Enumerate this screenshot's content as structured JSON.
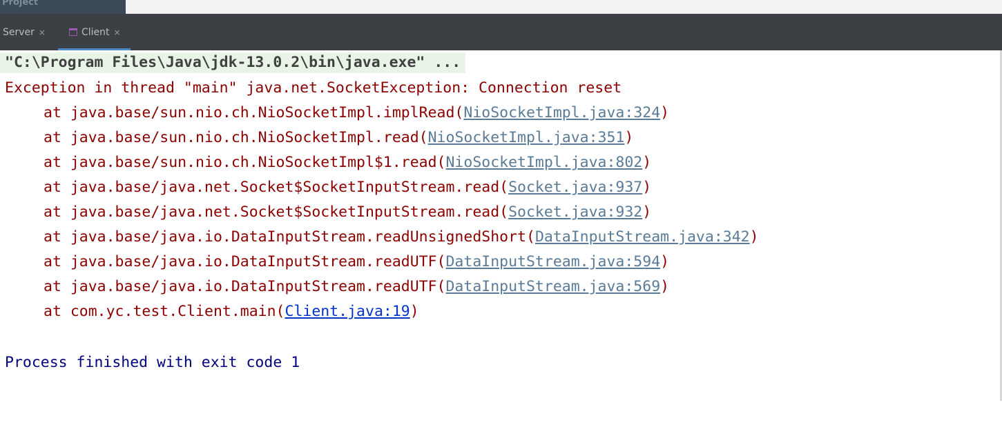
{
  "window": {
    "project_label": "Project"
  },
  "tabs": [
    {
      "label": "Server",
      "close": "×"
    },
    {
      "label": "Client",
      "close": "×",
      "icon": "window-icon",
      "active": true
    }
  ],
  "console": {
    "command": "\"C:\\Program Files\\Java\\jdk-13.0.2\\bin\\java.exe\" ...",
    "exception": "Exception in thread \"main\" java.net.SocketException: Connection reset",
    "trace": [
      {
        "text": "at java.base/sun.nio.ch.NioSocketImpl.implRead(",
        "link": "NioSocketImpl.java:324",
        "close": ")"
      },
      {
        "text": "at java.base/sun.nio.ch.NioSocketImpl.read(",
        "link": "NioSocketImpl.java:351",
        "close": ")"
      },
      {
        "text": "at java.base/sun.nio.ch.NioSocketImpl$1.read(",
        "link": "NioSocketImpl.java:802",
        "close": ")"
      },
      {
        "text": "at java.base/java.net.Socket$SocketInputStream.read(",
        "link": "Socket.java:937",
        "close": ")"
      },
      {
        "text": "at java.base/java.net.Socket$SocketInputStream.read(",
        "link": "Socket.java:932",
        "close": ")"
      },
      {
        "text": "at java.base/java.io.DataInputStream.readUnsignedShort(",
        "link": "DataInputStream.java:342",
        "close": ")"
      },
      {
        "text": "at java.base/java.io.DataInputStream.readUTF(",
        "link": "DataInputStream.java:594",
        "close": ")"
      },
      {
        "text": "at java.base/java.io.DataInputStream.readUTF(",
        "link": "DataInputStream.java:569",
        "close": ")"
      },
      {
        "text": "at com.yc.test.Client.main(",
        "link": "Client.java:19",
        "close": ")"
      }
    ],
    "exit_message": "Process finished with exit code 1"
  },
  "colors": {
    "tab_bar_bg": "#3c4044",
    "active_tab_accent": "#4a88c7",
    "error_text": "#8b0000",
    "library_link": "#5a7a96",
    "user_link": "#0033cc",
    "info_text": "#000080",
    "command_bg": "#e8f5e6"
  }
}
